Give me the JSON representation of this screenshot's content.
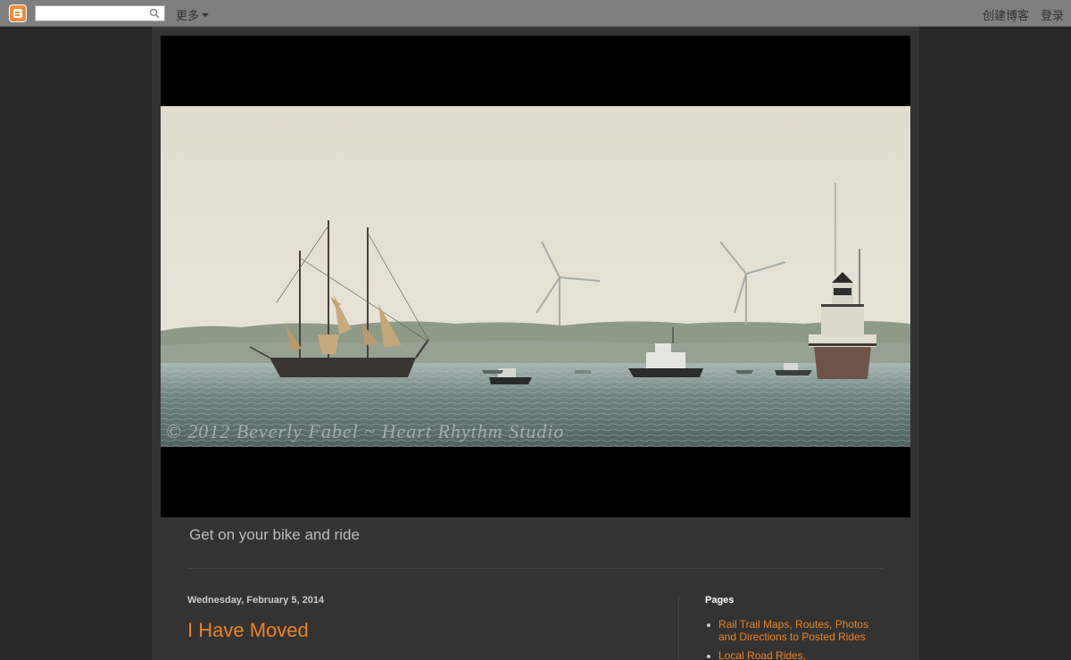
{
  "navbar": {
    "more_label": "更多",
    "create_blog": "创建博客",
    "sign_in": "登录",
    "search_placeholder": ""
  },
  "header": {
    "watermark": "© 2012 Beverly Fabel ~ Heart Rhythm Studio",
    "description": "Get on your bike and ride"
  },
  "post": {
    "date": "Wednesday, February 5, 2014",
    "title": "I Have Moved"
  },
  "sidebar": {
    "title": "Pages",
    "pages": [
      "Rail Trail Maps, Routes, Photos and Directions to Posted Rides",
      "Local Road Rides,"
    ]
  },
  "colors": {
    "link": "#ee8220",
    "navbar": "#7f7f7f",
    "background": "#292929",
    "content": "#333333",
    "blogger_brand": "#f58b3a"
  },
  "icons": [
    "blogger-logo-icon",
    "search-icon",
    "chevron-down-icon",
    "ship-icon",
    "wind-turbine-icon",
    "lighthouse-icon"
  ]
}
